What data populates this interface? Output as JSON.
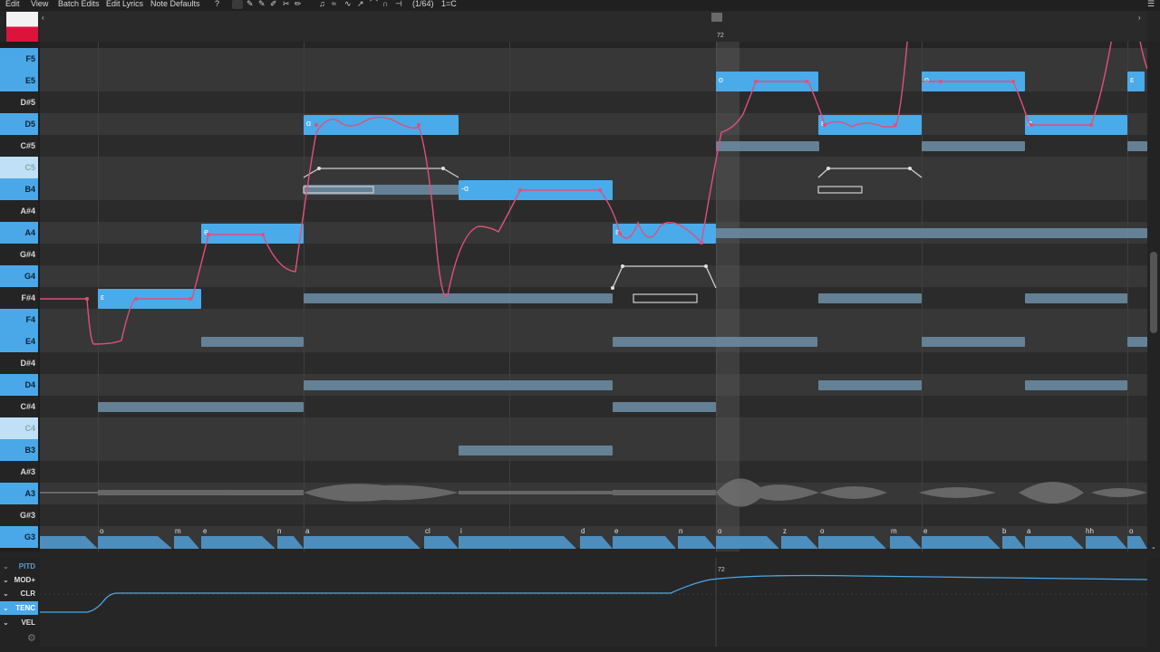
{
  "menu": {
    "items": [
      "Edit",
      "View",
      "Batch Edits",
      "Edit Lyrics",
      "Note Defaults"
    ],
    "help_label": "?",
    "quantize_label": "(1/64)",
    "key_label": "1=C"
  },
  "timeline": {
    "bar_label": "72",
    "param_bar_label": "72"
  },
  "piano_keys": [
    {
      "label": "F5",
      "color": "white"
    },
    {
      "label": "E5",
      "color": "white"
    },
    {
      "label": "D#5",
      "color": "black"
    },
    {
      "label": "D5",
      "color": "white"
    },
    {
      "label": "C#5",
      "color": "black"
    },
    {
      "label": "C5",
      "color": "white-pale"
    },
    {
      "label": "B4",
      "color": "white"
    },
    {
      "label": "A#4",
      "color": "black"
    },
    {
      "label": "A4",
      "color": "white"
    },
    {
      "label": "G#4",
      "color": "black"
    },
    {
      "label": "G4",
      "color": "white"
    },
    {
      "label": "F#4",
      "color": "black"
    },
    {
      "label": "F4",
      "color": "white"
    },
    {
      "label": "E4",
      "color": "white"
    },
    {
      "label": "D#4",
      "color": "black"
    },
    {
      "label": "D4",
      "color": "white"
    },
    {
      "label": "C#4",
      "color": "black"
    },
    {
      "label": "C4",
      "color": "white-pale"
    },
    {
      "label": "B3",
      "color": "white"
    },
    {
      "label": "A#3",
      "color": "black"
    },
    {
      "label": "A3",
      "color": "white"
    },
    {
      "label": "G#3",
      "color": "black"
    },
    {
      "label": "G3",
      "color": "white"
    }
  ],
  "notes": [
    {
      "lyric": "ε"
    },
    {
      "lyric": "e"
    },
    {
      "lyric": "ɑ"
    },
    {
      "lyric": "-ɑ"
    },
    {
      "lyric": "ɛ"
    },
    {
      "lyric": "o"
    },
    {
      "lyric": "ɛ"
    },
    {
      "lyric": "o"
    },
    {
      "lyric": "ɑ"
    },
    {
      "lyric": "ɛ"
    }
  ],
  "phonemes": [
    "o",
    "m",
    "e",
    "n",
    "a",
    "cl",
    "i",
    "d",
    "e",
    "n",
    "o",
    "z",
    "o",
    "m",
    "e",
    "b",
    "a",
    "hh",
    "o"
  ],
  "parameters": [
    {
      "label": "PITD",
      "state": "dim"
    },
    {
      "label": "MOD+",
      "state": "normal"
    },
    {
      "label": "CLR",
      "state": "normal"
    },
    {
      "label": "TENC",
      "state": "selected"
    },
    {
      "label": "VEL",
      "state": "normal"
    }
  ],
  "colors": {
    "accent": "#4aa8e8",
    "pitch_curve": "#e0507a",
    "ghost_note": "#6a8aa0",
    "param_curve": "#4aa8e8"
  }
}
